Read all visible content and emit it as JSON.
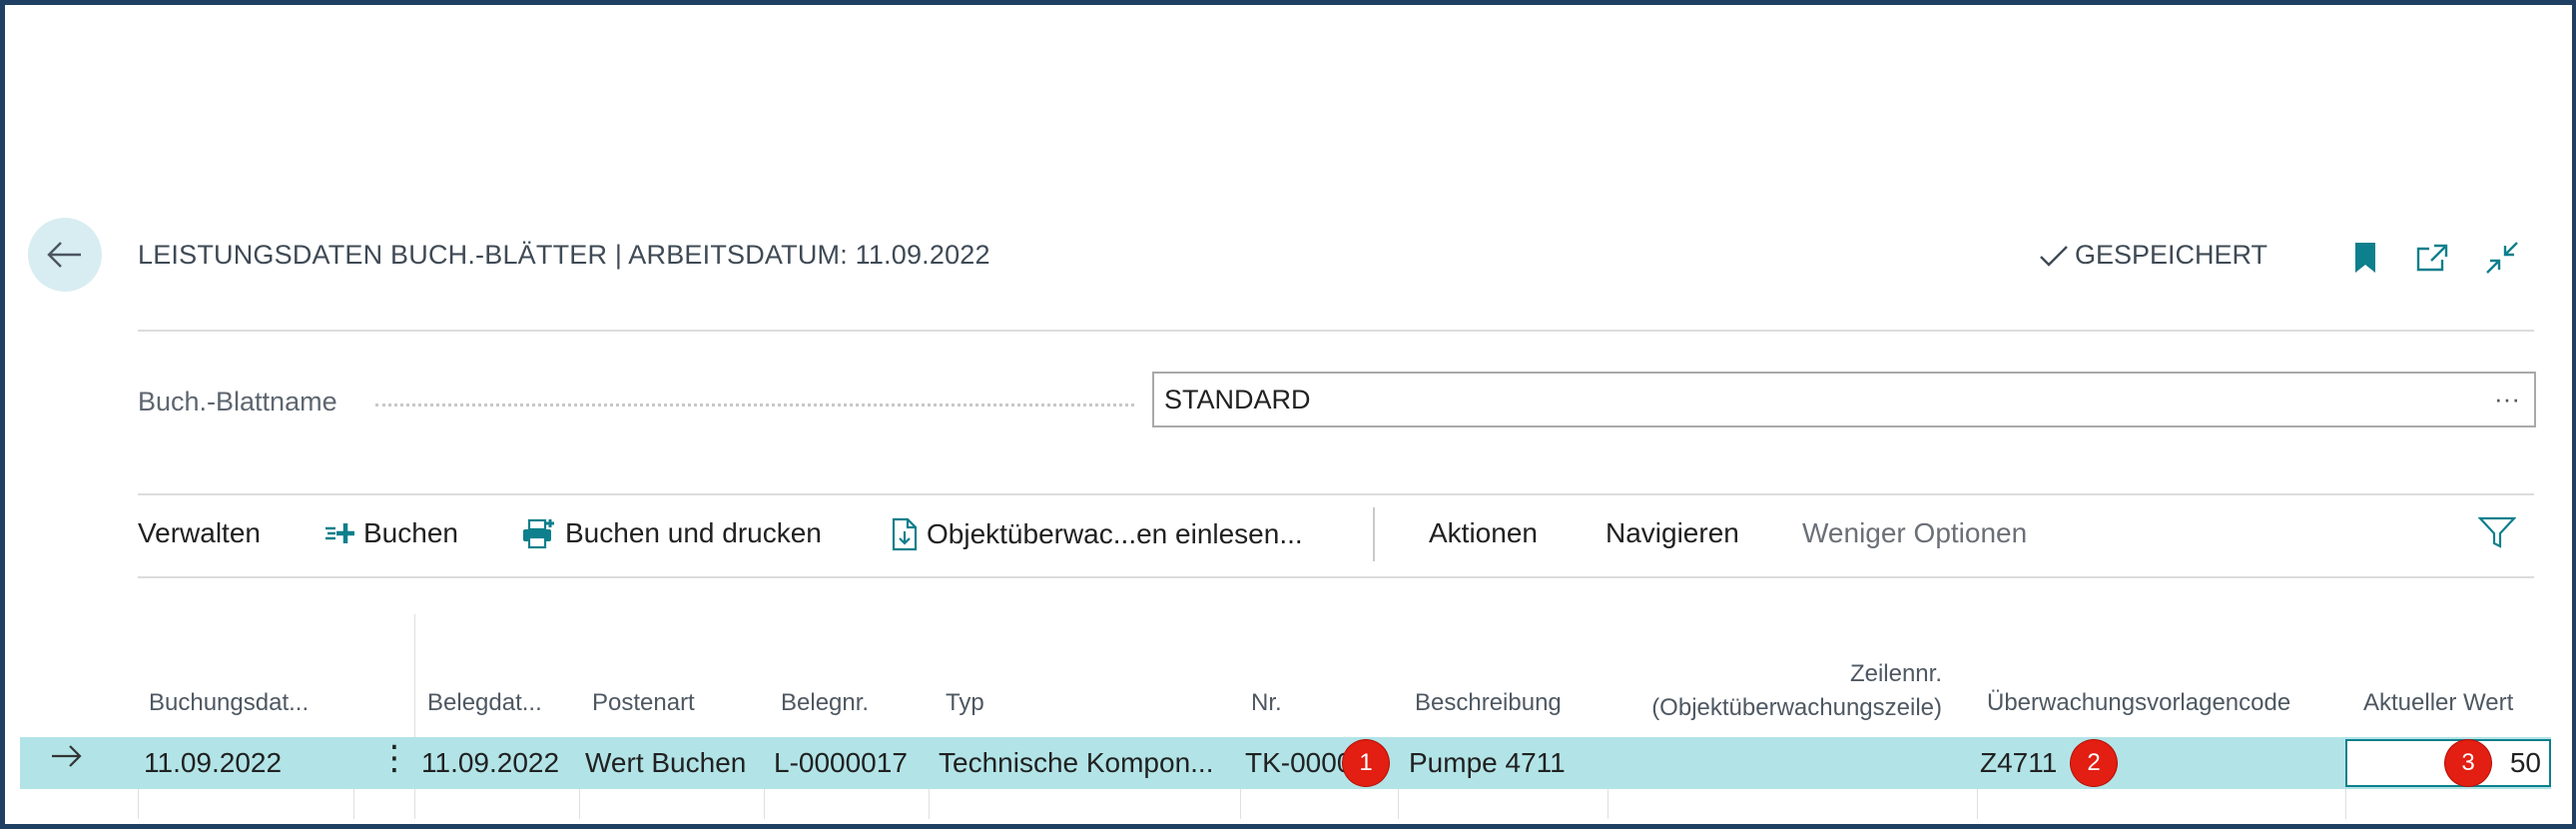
{
  "header": {
    "title": "LEISTUNGSDATEN BUCH.-BLÄTTER | ARBEITSDATUM: 11.09.2022",
    "saved_label": "GESPEICHERT",
    "icons": [
      "back-arrow-icon",
      "checkmark-icon",
      "bookmark-icon",
      "open-new-window-icon",
      "collapse-icon"
    ]
  },
  "batch": {
    "label": "Buch.-Blattname",
    "value": "STANDARD",
    "more": "···"
  },
  "toolbar": {
    "manage": "Verwalten",
    "post": "Buchen",
    "post_print": "Buchen und drucken",
    "import": "Objektüberwac...en einlesen...",
    "actions": "Aktionen",
    "navigate": "Navigieren",
    "fewer": "Weniger Optionen"
  },
  "grid": {
    "columns": {
      "posting_date": "Buchungsdat...",
      "doc_date": "Belegdat...",
      "entry_type": "Postenart",
      "doc_no": "Belegnr.",
      "type": "Typ",
      "no": "Nr.",
      "description": "Beschreibung",
      "line_no_1": "Zeilennr.",
      "line_no_2": "(Objektüberwachungszeile)",
      "template_code": "Überwachungsvorlagencode",
      "current_value": "Aktueller Wert"
    },
    "row": {
      "posting_date": "11.09.2022",
      "doc_date": "11.09.2022",
      "entry_type": "Wert Buchen",
      "doc_no": "L-0000017",
      "type": "Technische Kompon...",
      "no": "TK-0000",
      "description": "Pumpe 4711",
      "line_no": "",
      "template_code": "Z4711",
      "current_value": "50"
    }
  },
  "badges": [
    "1",
    "2",
    "3"
  ],
  "colors": {
    "accent": "#0e7f8c",
    "selected_row": "#b2e4e7",
    "badge": "#e31e12",
    "frame": "#1f3f63"
  }
}
